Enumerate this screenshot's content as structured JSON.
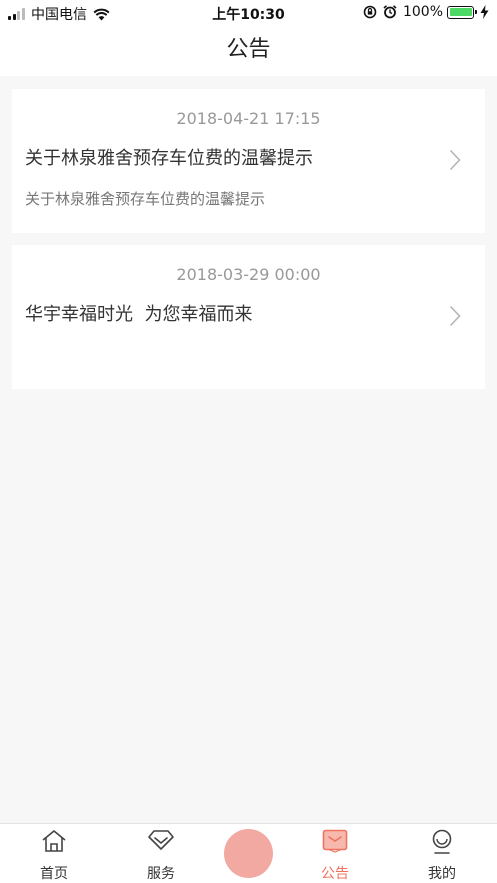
{
  "status_bar": {
    "carrier": "中国电信",
    "time": "上午10:30",
    "battery_percent": "100%",
    "battery_level": 1.0
  },
  "nav": {
    "title": "公告"
  },
  "notices": [
    {
      "date": "2018-04-21 17:15",
      "title": "关于林泉雅舍预存车位费的温馨提示",
      "summary": "关于林泉雅舍预存车位费的温馨提示"
    },
    {
      "date": "2018-03-29 00:00",
      "title": "华宇幸福时光  为您幸福而来",
      "summary": ""
    }
  ],
  "tab_bar": {
    "home": {
      "label": "首页",
      "icon": "home-icon"
    },
    "service": {
      "label": "服务",
      "icon": "diamond-icon"
    },
    "center": {
      "icon": "center-action-icon"
    },
    "notice": {
      "label": "公告",
      "icon": "message-icon",
      "active": true
    },
    "mine": {
      "label": "我的",
      "icon": "user-icon"
    }
  },
  "colors": {
    "accent": "#f0735f",
    "center_button": "#f2a9a2",
    "background": "#f7f7f7"
  }
}
